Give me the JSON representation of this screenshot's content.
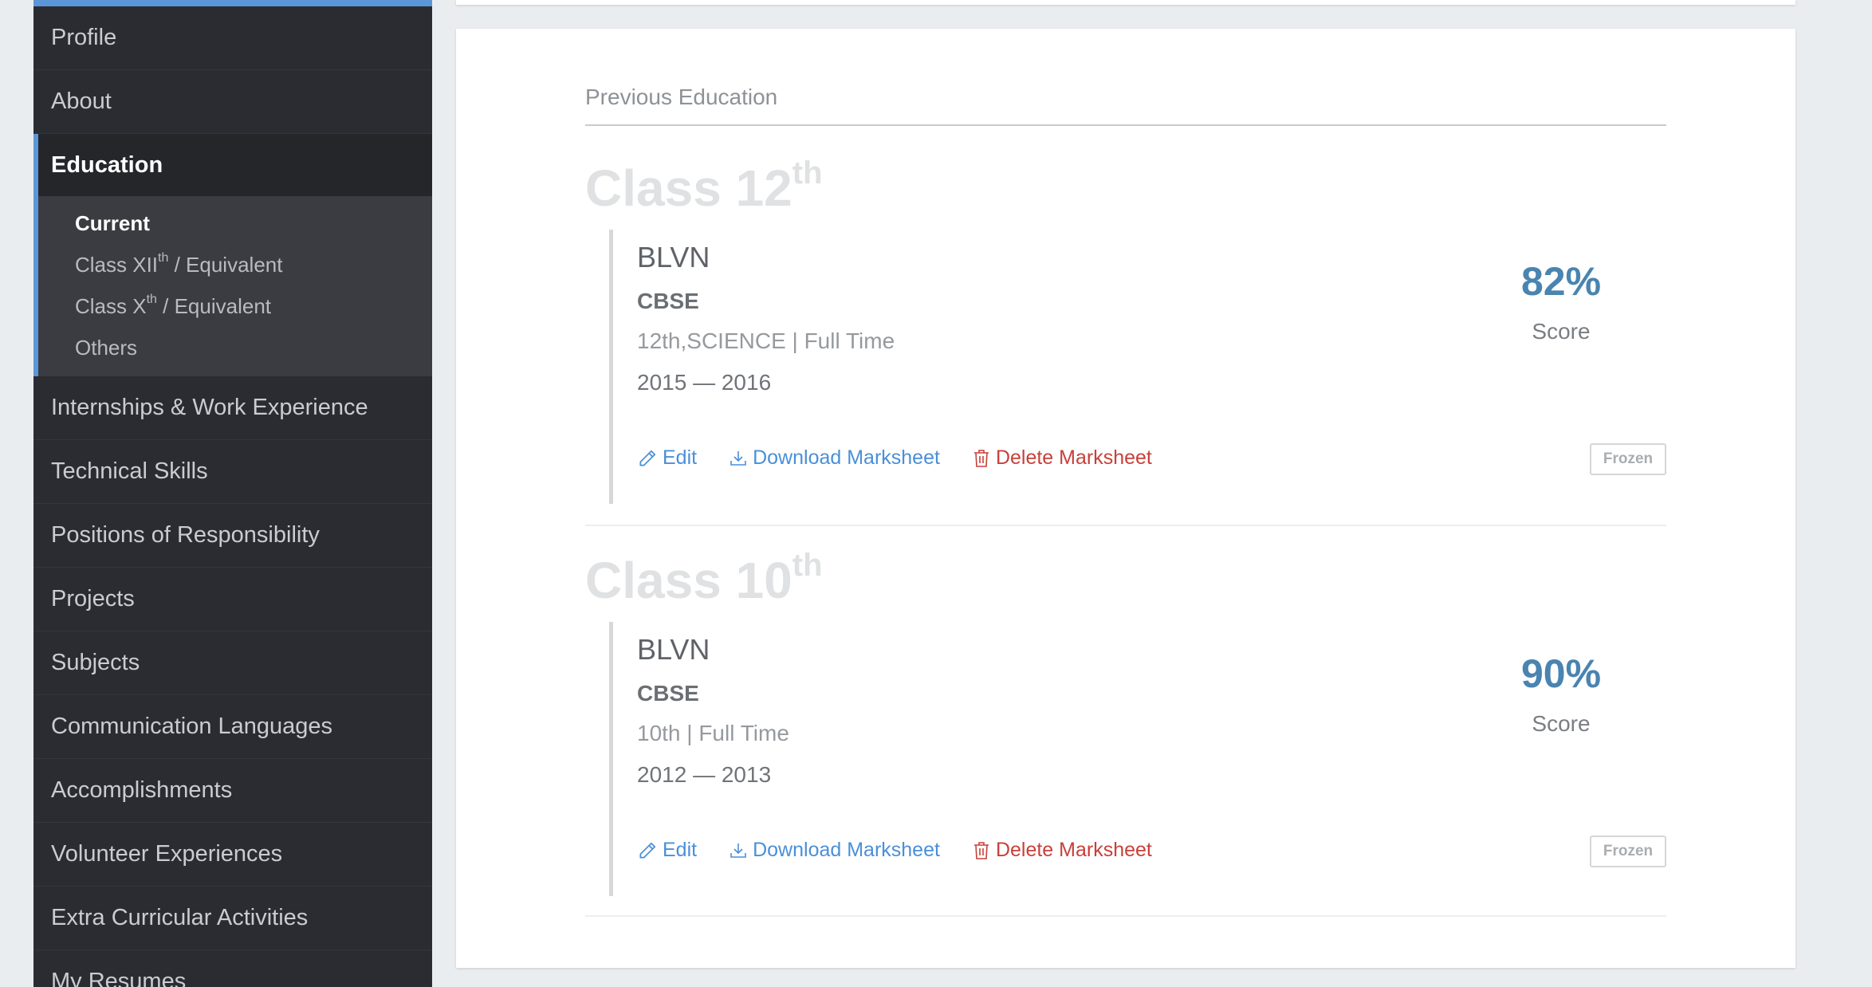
{
  "sidebar": {
    "items_before": [
      {
        "label": "Profile"
      },
      {
        "label": "About"
      }
    ],
    "active_item": {
      "label": "Education"
    },
    "subitems": [
      {
        "label": "Current",
        "sup": "",
        "suffix": ""
      },
      {
        "label": "Class XII",
        "sup": "th",
        "suffix": " / Equivalent"
      },
      {
        "label": "Class X",
        "sup": "th",
        "suffix": " / Equivalent"
      },
      {
        "label": "Others",
        "sup": "",
        "suffix": ""
      }
    ],
    "items_after": [
      {
        "label": "Internships & Work Experience"
      },
      {
        "label": "Technical Skills"
      },
      {
        "label": "Positions of Responsibility"
      },
      {
        "label": "Projects"
      },
      {
        "label": "Subjects"
      },
      {
        "label": "Communication Languages"
      },
      {
        "label": "Accomplishments"
      },
      {
        "label": "Volunteer Experiences"
      },
      {
        "label": "Extra Curricular Activities"
      },
      {
        "label": "My Resumes"
      }
    ]
  },
  "main": {
    "section_title": "Previous Education",
    "entries": [
      {
        "heading": "Class 12",
        "heading_sup": "th",
        "institution": "BLVN",
        "board": "CBSE",
        "stream": "12th,SCIENCE | Full Time",
        "years": "2015 — 2016",
        "score": "82%",
        "score_label": "Score",
        "edit_label": "Edit",
        "download_label": "Download Marksheet",
        "delete_label": "Delete Marksheet",
        "status": "Frozen"
      },
      {
        "heading": "Class 10",
        "heading_sup": "th",
        "institution": "BLVN",
        "board": "CBSE",
        "stream": "10th | Full Time",
        "years": "2012 — 2013",
        "score": "90%",
        "score_label": "Score",
        "edit_label": "Edit",
        "download_label": "Download Marksheet",
        "delete_label": "Delete Marksheet",
        "status": "Frozen"
      }
    ]
  },
  "colors": {
    "accent": "#5b96d8",
    "sidebar_bg": "#2a2c31",
    "link_blue": "#4a8fd9",
    "delete_red": "#c8403a",
    "score_blue": "#4a84b0"
  }
}
